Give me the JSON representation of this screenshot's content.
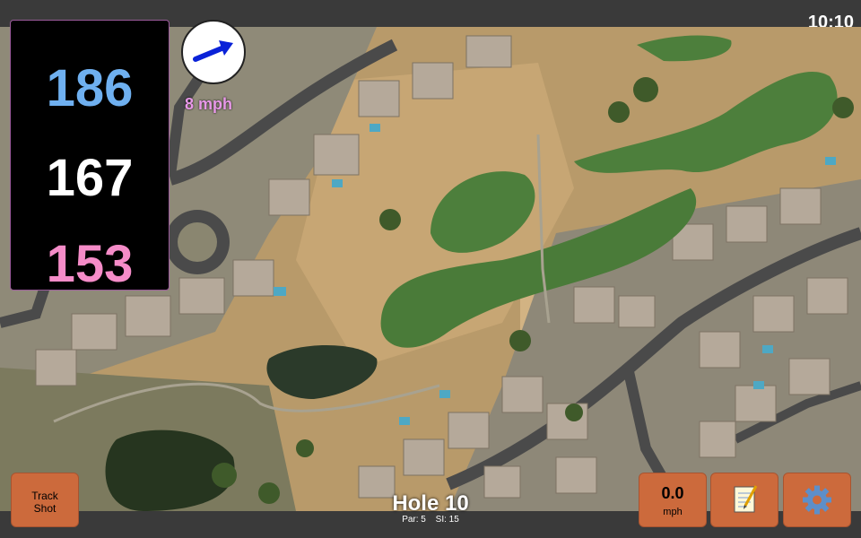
{
  "status": {
    "time": "10:10"
  },
  "distances": {
    "back": "186",
    "middle": "167",
    "front": "153"
  },
  "wind": {
    "speed_label": "8 mph",
    "direction_icon": "wind-arrow-icon"
  },
  "hole": {
    "name": "Hole 10",
    "par_label": "Par: 5",
    "si_label": "SI: 15"
  },
  "buttons": {
    "track_line1": "Track",
    "track_line2": "Shot",
    "speed_value": "0.0",
    "speed_unit": "mph",
    "notes_icon": "notepad-icon",
    "settings_icon": "gear-icon"
  },
  "colors": {
    "back": "#6fb0f0",
    "middle": "#ffffff",
    "front": "#f58cc8",
    "button": "#cc6a3c",
    "wind_text": "#e898e8"
  }
}
